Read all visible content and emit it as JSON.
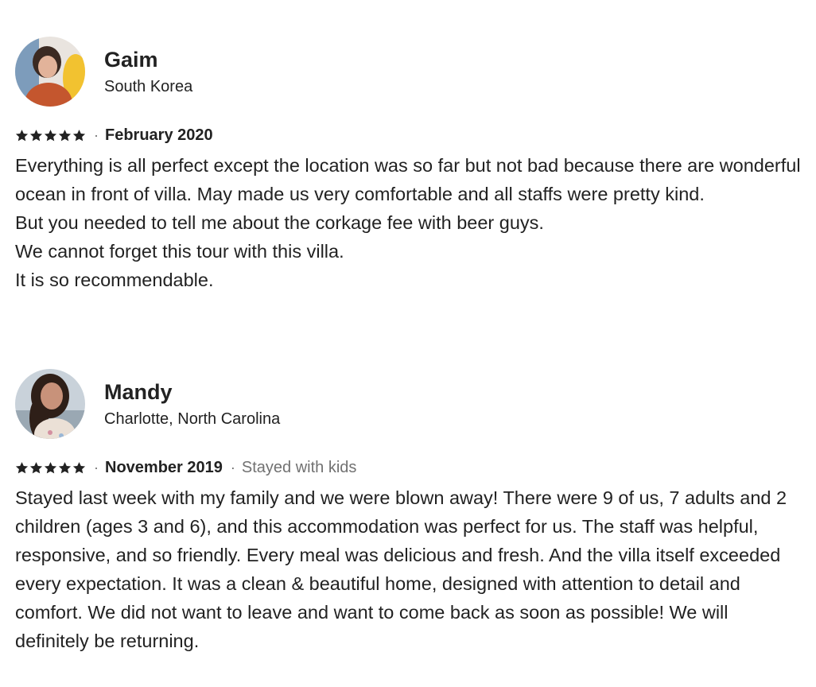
{
  "reviews": [
    {
      "name": "Gaim",
      "location": "South Korea",
      "rating": 5,
      "date": "February 2020",
      "trip_type": "",
      "paragraphs": [
        "Everything is all perfect except the location was so far but not bad because there are wonderful ocean in front of villa. May made us very comfortable and all staffs were pretty kind.",
        "But you needed to tell me about the corkage fee with beer guys.",
        "We cannot forget this tour with this villa.",
        "It is so recommendable."
      ],
      "avatar_colors": [
        "#6c8fb0",
        "#c4562e",
        "#f2c230"
      ]
    },
    {
      "name": "Mandy",
      "location": "Charlotte, North Carolina",
      "rating": 5,
      "date": "November 2019",
      "trip_type": "Stayed with kids",
      "paragraphs": [
        "Stayed last week with my family and we were blown away! There were 9 of us, 7 adults and 2 children (ages 3 and 6), and this accommodation was perfect for us. The staff was helpful, responsive, and so friendly. Every meal was delicious and fresh. And the villa itself exceeded every expectation. It was a clean & beautiful home, designed with attention to detail and comfort. We did not want to leave and want to come back as soon as possible! We will definitely be returning."
      ],
      "avatar_colors": [
        "#b7c2cc",
        "#3a2a22",
        "#e7d9d0"
      ]
    }
  ],
  "star_icon": "star-icon",
  "separator": "·"
}
